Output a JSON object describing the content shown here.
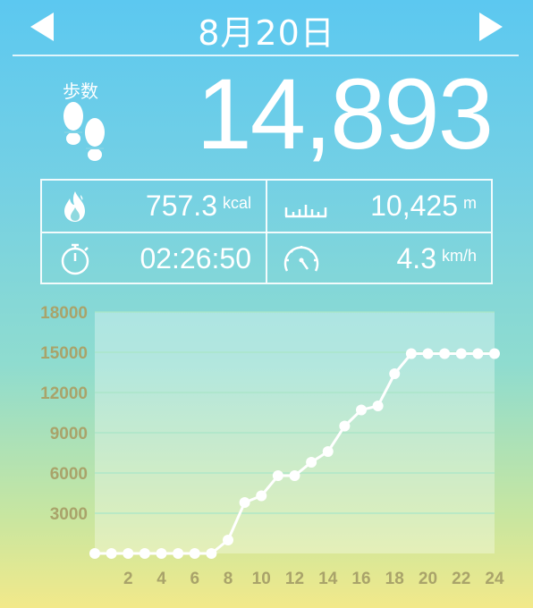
{
  "header": {
    "date": "8月20日"
  },
  "steps": {
    "label": "歩数",
    "value": "14,893"
  },
  "stats": {
    "calories": {
      "value": "757.3",
      "unit": "kcal"
    },
    "distance": {
      "value": "10,425",
      "unit": "m"
    },
    "time": {
      "value": "02:26:50"
    },
    "speed": {
      "value": "4.3",
      "unit": "km/h"
    }
  },
  "colors": {
    "accent": "#ffffff",
    "axis_text": "#a9a36a"
  },
  "chart_data": {
    "type": "line",
    "x": [
      0,
      1,
      2,
      3,
      4,
      5,
      6,
      7,
      8,
      9,
      10,
      11,
      12,
      13,
      14,
      15,
      16,
      17,
      18,
      19,
      20,
      21,
      22,
      23,
      24
    ],
    "values": [
      0,
      0,
      0,
      0,
      0,
      0,
      0,
      0,
      1000,
      3800,
      4300,
      5800,
      5800,
      6800,
      7600,
      9500,
      10700,
      11000,
      13400,
      14900,
      14900,
      14900,
      14900,
      14900,
      14900
    ],
    "x_tick_labels": [
      "2",
      "4",
      "6",
      "8",
      "10",
      "12",
      "14",
      "16",
      "18",
      "20",
      "22",
      "24"
    ],
    "y_tick_labels": [
      "18000",
      "15000",
      "12000",
      "9000",
      "6000",
      "3000"
    ],
    "ylim": [
      0,
      18000
    ],
    "xlim": [
      0,
      24
    ],
    "grid": true
  }
}
